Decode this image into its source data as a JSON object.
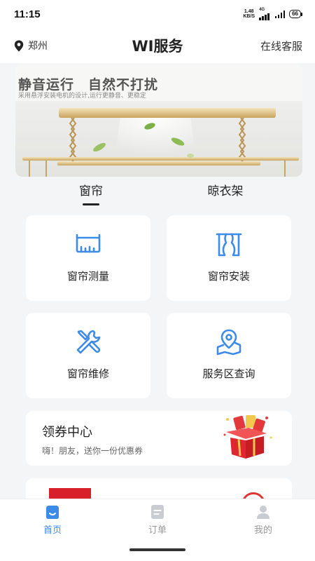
{
  "status_bar": {
    "time": "11:15",
    "net_speed_value": "1.48",
    "net_speed_unit": "KB/S",
    "network": "4G",
    "battery": "66"
  },
  "header": {
    "location": "郑州",
    "title": "WI服务",
    "service_link": "在线客服"
  },
  "banner": {
    "title": "静音运行　自然不打扰",
    "subtitle": "采用悬浮安装电机的设计,运行更静音、更稳定"
  },
  "tabs": [
    {
      "label": "窗帘",
      "active": true
    },
    {
      "label": "晾衣架",
      "active": false
    }
  ],
  "services": [
    {
      "label": "窗帘测量",
      "icon": "ruler-icon"
    },
    {
      "label": "窗帘安装",
      "icon": "curtain-icon"
    },
    {
      "label": "窗帘维修",
      "icon": "tools-icon"
    },
    {
      "label": "服务区查询",
      "icon": "location-map-icon"
    }
  ],
  "coupon": {
    "title": "领券中心",
    "subtitle": "嗨！朋友，送你一份优惠券"
  },
  "bottom_nav": [
    {
      "label": "首页",
      "icon": "home-icon",
      "active": true
    },
    {
      "label": "订单",
      "icon": "order-icon",
      "active": false
    },
    {
      "label": "我的",
      "icon": "profile-icon",
      "active": false
    }
  ],
  "colors": {
    "accent": "#3d8be8",
    "text": "#222222",
    "background": "#f4f5f7",
    "coupon_red": "#e0262e"
  }
}
